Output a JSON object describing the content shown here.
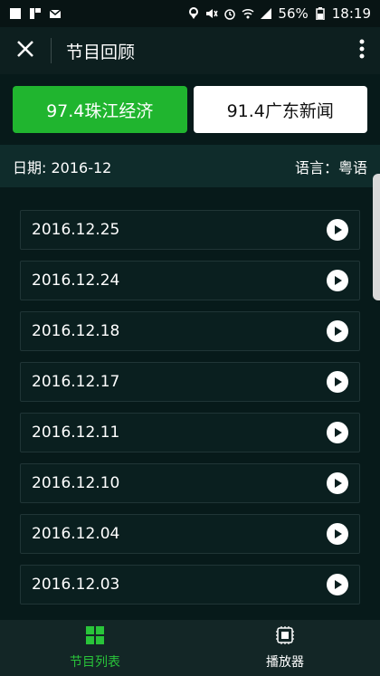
{
  "status_bar": {
    "battery": "56%",
    "time": "18:19"
  },
  "header": {
    "title": "节目回顾"
  },
  "tabs": [
    {
      "label": "97.4珠江经济"
    },
    {
      "label": "91.4广东新闻"
    }
  ],
  "info": {
    "date": "日期: 2016-12",
    "language": "语言：粤语"
  },
  "episodes": [
    {
      "date": "2016.12.25"
    },
    {
      "date": "2016.12.24"
    },
    {
      "date": "2016.12.18"
    },
    {
      "date": "2016.12.17"
    },
    {
      "date": "2016.12.11"
    },
    {
      "date": "2016.12.10"
    },
    {
      "date": "2016.12.04"
    },
    {
      "date": "2016.12.03"
    }
  ],
  "bottom_nav": {
    "list_label": "节目列表",
    "player_label": "播放器"
  },
  "colors": {
    "accent": "#20b52f",
    "background": "#071a1a"
  }
}
